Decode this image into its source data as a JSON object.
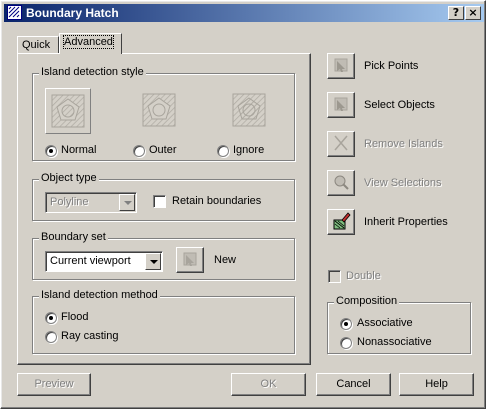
{
  "window": {
    "title": "Boundary Hatch",
    "help_button": "?",
    "close_button": "×"
  },
  "tabs": [
    {
      "label": "Quick"
    },
    {
      "label": "Advanced"
    }
  ],
  "island_detection_style": {
    "label": "Island detection style",
    "options": [
      {
        "label": "Normal",
        "checked": true
      },
      {
        "label": "Outer",
        "checked": false
      },
      {
        "label": "Ignore",
        "checked": false
      }
    ]
  },
  "object_type": {
    "label": "Object type",
    "value": "Polyline",
    "retain_boundaries_label": "Retain boundaries",
    "retain_boundaries_checked": false
  },
  "boundary_set": {
    "label": "Boundary set",
    "value": "Current viewport",
    "new_label": "New"
  },
  "island_detection_method": {
    "label": "Island detection method",
    "options": [
      {
        "label": "Flood",
        "checked": true
      },
      {
        "label": "Ray casting",
        "checked": false
      }
    ]
  },
  "right_actions": [
    {
      "label": "Pick Points",
      "enabled": true
    },
    {
      "label": "Select Objects",
      "enabled": true
    },
    {
      "label": "Remove Islands",
      "enabled": false
    },
    {
      "label": "View Selections",
      "enabled": false
    },
    {
      "label": "Inherit Properties",
      "enabled": true
    }
  ],
  "double": {
    "label": "Double",
    "checked": false,
    "enabled": false
  },
  "composition": {
    "label": "Composition",
    "options": [
      {
        "label": "Associative",
        "checked": true
      },
      {
        "label": "Nonassociative",
        "checked": false
      }
    ]
  },
  "footer": {
    "preview_label": "Preview",
    "ok_label": "OK",
    "cancel_label": "Cancel",
    "help_label": "Help"
  }
}
